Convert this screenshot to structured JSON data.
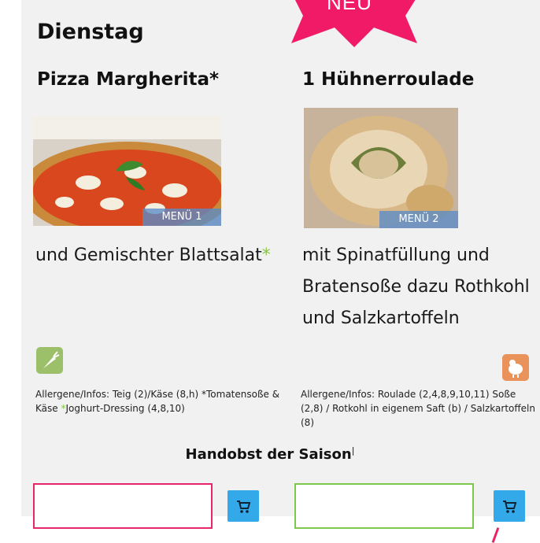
{
  "badge": {
    "text": "NEU",
    "color": "#e8246a"
  },
  "day": "Dienstag",
  "menus": [
    {
      "title": "Pizza Margherita*",
      "tag": "MENÜ 1",
      "desc_main": "und Gemischter Blattsalat",
      "desc_mark": "*",
      "diet_icon": "carrot-icon",
      "info_a": "Allergene/Infos: Teig (2)/Käse (8,h) *Tomatensoße & Käse ",
      "info_mark": "*",
      "info_b": "Joghurt-Dressing (4,8,10)",
      "border_color": "#e8246a"
    },
    {
      "title": "1 Hühnerroulade",
      "tag": "MENÜ 2",
      "desc": "mit Spinatfüllung und Bratensoße dazu Rothkohl und Salzkartoffeln",
      "diet_icon": "chicken-icon",
      "info": "Allergene/Infos: Roulade (2,4,8,9,10,11) Soße (2,8) / Rotkohl in eigenem Saft (b) / Salzkartoffeln (8)",
      "border_color": "#7dc84c"
    }
  ],
  "dessert": {
    "label": "Handobst der Saison",
    "mark": "|"
  },
  "cart_icon": "cart-icon",
  "colors": {
    "accent_blue": "#33a9ea",
    "panel_bg": "#f1f1f1"
  }
}
